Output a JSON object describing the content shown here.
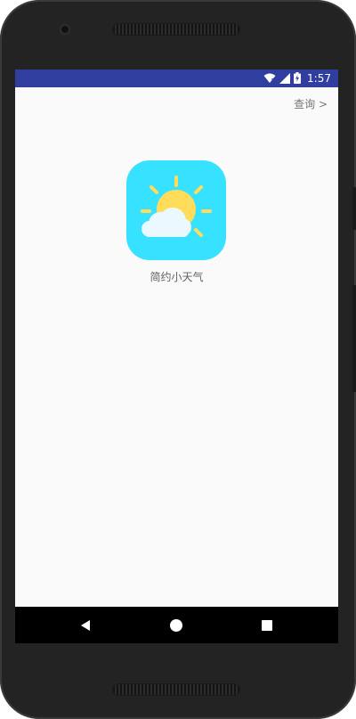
{
  "status_bar": {
    "time": "1:57",
    "icons": [
      "wifi-icon",
      "cellular-signal-icon",
      "battery-charging-icon"
    ]
  },
  "header": {
    "query_link": "查询 >"
  },
  "app": {
    "icon": "sun-cloud-icon",
    "name": "简约小天气",
    "icon_color": "#36e2ff"
  },
  "nav_bar": {
    "buttons": [
      "back-icon",
      "home-icon",
      "recents-icon"
    ]
  },
  "colors": {
    "status_bar": "#303f9f",
    "background": "#fafafa",
    "sun": "#ffdc5a",
    "cloud": "#eaf8ff"
  }
}
